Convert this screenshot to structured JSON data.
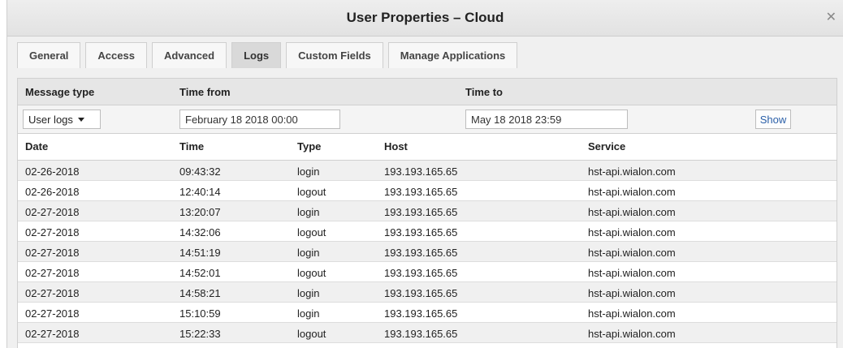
{
  "dialog": {
    "title": "User Properties – Cloud",
    "close_icon": "close-icon"
  },
  "tabs": [
    {
      "label": "General"
    },
    {
      "label": "Access"
    },
    {
      "label": "Advanced"
    },
    {
      "label": "Logs",
      "active": true
    },
    {
      "label": "Custom Fields"
    },
    {
      "label": "Manage Applications"
    }
  ],
  "filters": {
    "message_type_label": "Message type",
    "time_from_label": "Time from",
    "time_to_label": "Time to",
    "message_type_value": "User logs",
    "time_from_value": "February 18 2018 00:00",
    "time_to_value": "May 18 2018 23:59",
    "show_label": "Show"
  },
  "table": {
    "headers": [
      "Date",
      "Time",
      "Type",
      "Host",
      "Service"
    ],
    "rows": [
      [
        "02-26-2018",
        "09:43:32",
        "login",
        "193.193.165.65",
        "hst-api.wialon.com"
      ],
      [
        "02-26-2018",
        "12:40:14",
        "logout",
        "193.193.165.65",
        "hst-api.wialon.com"
      ],
      [
        "02-27-2018",
        "13:20:07",
        "login",
        "193.193.165.65",
        "hst-api.wialon.com"
      ],
      [
        "02-27-2018",
        "14:32:06",
        "logout",
        "193.193.165.65",
        "hst-api.wialon.com"
      ],
      [
        "02-27-2018",
        "14:51:19",
        "login",
        "193.193.165.65",
        "hst-api.wialon.com"
      ],
      [
        "02-27-2018",
        "14:52:01",
        "logout",
        "193.193.165.65",
        "hst-api.wialon.com"
      ],
      [
        "02-27-2018",
        "14:58:21",
        "login",
        "193.193.165.65",
        "hst-api.wialon.com"
      ],
      [
        "02-27-2018",
        "15:10:59",
        "login",
        "193.193.165.65",
        "hst-api.wialon.com"
      ],
      [
        "02-27-2018",
        "15:22:33",
        "logout",
        "193.193.165.65",
        "hst-api.wialon.com"
      ]
    ]
  }
}
